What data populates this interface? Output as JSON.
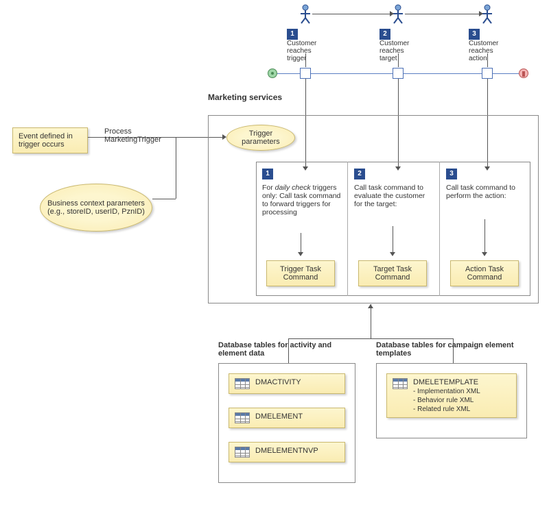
{
  "top": {
    "steps": [
      {
        "n": "1",
        "label": "Customer reaches trigger"
      },
      {
        "n": "2",
        "label": "Customer reaches target"
      },
      {
        "n": "3",
        "label": "Customer reaches action"
      }
    ]
  },
  "left": {
    "event_box": "Event defined in trigger occurs",
    "process_label": "Process MarketingTrigger",
    "biz_ctx": "Business context parameters (e.g., storeID, userID, PznID)"
  },
  "marketing": {
    "title": "Marketing services",
    "trigger_params": "Trigger parameters",
    "panels": [
      {
        "n": "1",
        "desc_a": "For ",
        "desc_i": "daily check",
        "desc_b": " triggers only: Call task command to forward triggers for processing",
        "cmd": "Trigger Task Command"
      },
      {
        "n": "2",
        "desc": "Call task command to evaluate the customer for the target:",
        "cmd": "Target Task Command"
      },
      {
        "n": "3",
        "desc": "Call task command to perform the action:",
        "cmd": "Action Task Command"
      }
    ]
  },
  "db": {
    "left_title": "Database tables for activity and element data",
    "right_title": "Database tables for campaign element templates",
    "left_tables": [
      "DMACTIVITY",
      "DMELEMENT",
      "DMELEMENTNVP"
    ],
    "right_table": {
      "name": "DMELETEMPLATE",
      "subs": [
        "- Implementation XML",
        "- Behavior rule XML",
        "- Related rule XML"
      ]
    }
  }
}
